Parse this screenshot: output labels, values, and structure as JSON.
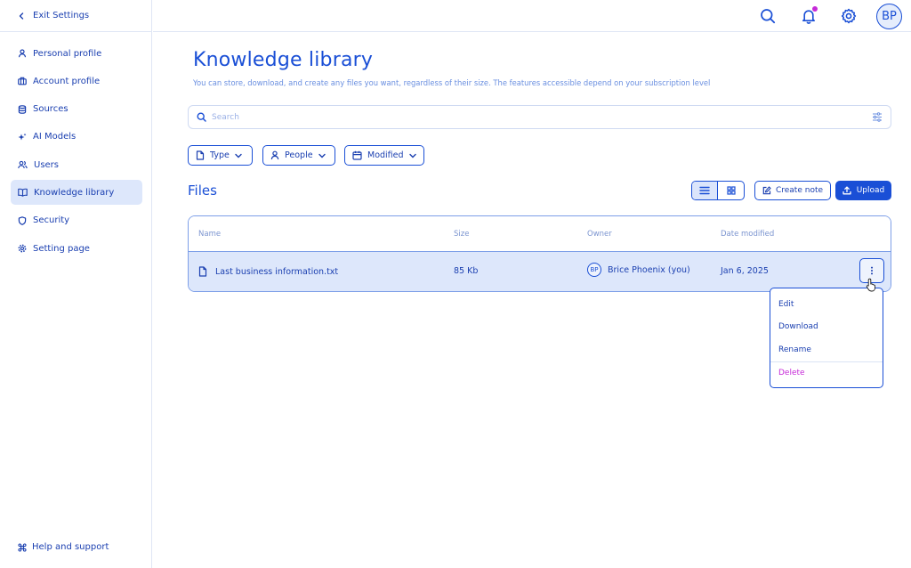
{
  "sidebar": {
    "exit_label": "Exit Settings",
    "items": [
      {
        "label": "Personal profile",
        "icon": "user-icon"
      },
      {
        "label": "Account profile",
        "icon": "briefcase-icon"
      },
      {
        "label": "Sources",
        "icon": "database-icon"
      },
      {
        "label": "AI Models",
        "icon": "sparkle-icon"
      },
      {
        "label": "Users",
        "icon": "users-icon"
      },
      {
        "label": "Knowledge library",
        "icon": "book-icon",
        "active": true
      },
      {
        "label": "Security",
        "icon": "shield-icon"
      },
      {
        "label": "Setting page",
        "icon": "gear-icon"
      }
    ],
    "help_label": "Help and support"
  },
  "topbar": {
    "avatar_initials": "BP",
    "notification_dot_color": "#c62ad8"
  },
  "page": {
    "title": "Knowledge library",
    "subtitle": "You can store, download, and create any files you want, regardless of their size. The features accessible depend on your subscription level"
  },
  "search": {
    "placeholder": "Search",
    "value": ""
  },
  "filters": [
    {
      "label": "Type",
      "icon": "file-icon"
    },
    {
      "label": "People",
      "icon": "user-icon"
    },
    {
      "label": "Modified",
      "icon": "calendar-icon"
    }
  ],
  "files": {
    "title": "Files",
    "create_note_label": "Create note",
    "upload_label": "Upload",
    "columns": [
      "Name",
      "Size",
      "Owner",
      "Date modified"
    ],
    "rows": [
      {
        "name": "Last business information.txt",
        "size": "85 Kb",
        "owner_initials": "BP",
        "owner": "Brice Phoenix (you)",
        "date_modified": "Jan 6, 2025"
      }
    ]
  },
  "context_menu": {
    "items": [
      "Edit",
      "Download",
      "Rename",
      "Delete"
    ]
  },
  "colors": {
    "accent": "#1a4fd6",
    "active_bg": "#dde7fb",
    "danger": "#c62ad8"
  }
}
